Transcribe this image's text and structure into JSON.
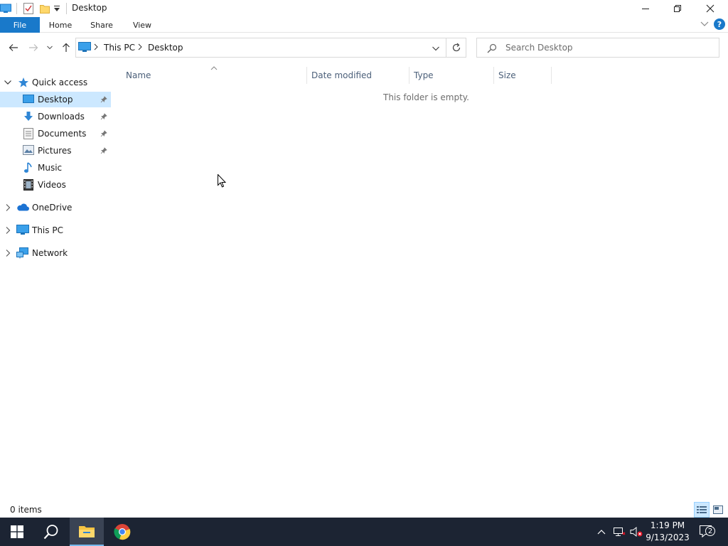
{
  "window": {
    "title": "Desktop",
    "controls": {
      "minimize": "—",
      "maximize": "❐",
      "close": "✕"
    }
  },
  "ribbon": {
    "tabs": [
      {
        "label": "File"
      },
      {
        "label": "Home"
      },
      {
        "label": "Share"
      },
      {
        "label": "View"
      }
    ],
    "help": "?"
  },
  "address": {
    "breadcrumbs": [
      "This PC",
      "Desktop"
    ],
    "search_placeholder": "Search Desktop"
  },
  "nav": {
    "quick_access": "Quick access",
    "items": [
      {
        "label": "Desktop",
        "icon": "desktop-icon",
        "pinned": true,
        "selected": true
      },
      {
        "label": "Downloads",
        "icon": "downloads-icon",
        "pinned": true
      },
      {
        "label": "Documents",
        "icon": "documents-icon",
        "pinned": true
      },
      {
        "label": "Pictures",
        "icon": "pictures-icon",
        "pinned": true
      },
      {
        "label": "Music",
        "icon": "music-icon"
      },
      {
        "label": "Videos",
        "icon": "videos-icon"
      }
    ],
    "roots": [
      {
        "label": "OneDrive",
        "icon": "onedrive-icon"
      },
      {
        "label": "This PC",
        "icon": "this-pc-icon"
      },
      {
        "label": "Network",
        "icon": "network-icon"
      }
    ]
  },
  "content": {
    "columns": [
      {
        "label": "Name"
      },
      {
        "label": "Date modified"
      },
      {
        "label": "Type"
      },
      {
        "label": "Size"
      }
    ],
    "empty_message": "This folder is empty."
  },
  "status": {
    "item_count": "0 items"
  },
  "taskbar": {
    "time": "1:19 PM",
    "date": "9/13/2023",
    "notification_count": "2"
  },
  "colors": {
    "accent": "#1979ca",
    "selection": "#cce8ff",
    "taskbar": "#1c2433"
  }
}
